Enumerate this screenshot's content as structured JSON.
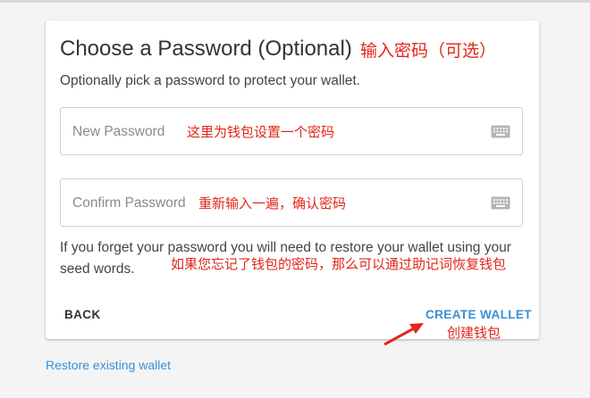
{
  "card": {
    "title": "Choose a Password (Optional)",
    "title_annotation": "输入密码（可选）",
    "subtitle": "Optionally pick a password to protect your wallet.",
    "new_password": {
      "placeholder": "New Password",
      "annotation": "这里为钱包设置一个密码",
      "icon": "keyboard-icon"
    },
    "confirm_password": {
      "placeholder": "Confirm Password",
      "annotation": "重新输入一遍，确认密码",
      "icon": "keyboard-icon"
    },
    "forget_note": "If you forget your password you will need to restore your wallet using your seed words.",
    "forget_note_annotation": "如果您忘记了钱包的密码，那么可以通过助记词恢复钱包",
    "back_label": "BACK",
    "create_label": "CREATE WALLET",
    "create_annotation": "创建钱包"
  },
  "restore_link": "Restore existing wallet",
  "colors": {
    "accent": "#3a8fd6",
    "annotation": "#e0271b",
    "background": "#f4f4f4"
  }
}
